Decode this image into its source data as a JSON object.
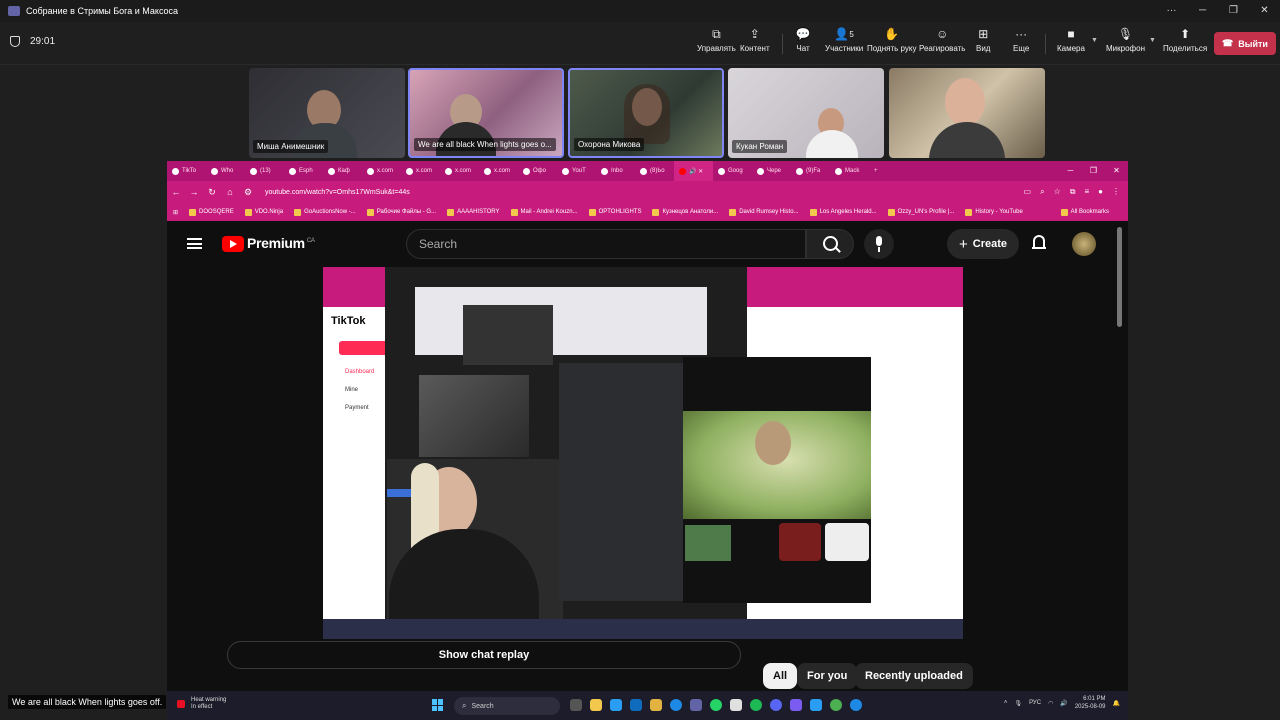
{
  "teams": {
    "window_title": "Собрание в Стримы Бога и Максоса",
    "timer": "29:01",
    "tools": [
      {
        "label": "Управлять",
        "icon": "control-icon"
      },
      {
        "label": "Контент",
        "icon": "share-content-icon"
      },
      {
        "label": "Чат",
        "icon": "chat-icon"
      },
      {
        "label": "Участники",
        "icon": "participants-icon",
        "count": "5"
      },
      {
        "label": "Поднять руку",
        "icon": "raise-hand-icon"
      },
      {
        "label": "Реагировать",
        "icon": "react-icon"
      },
      {
        "label": "Вид",
        "icon": "view-icon"
      },
      {
        "label": "Еще",
        "icon": "more-icon"
      },
      {
        "label": "Камера",
        "icon": "camera-icon"
      },
      {
        "label": "Микрофон",
        "icon": "microphone-icon"
      },
      {
        "label": "Поделиться",
        "icon": "share-icon"
      }
    ],
    "leave_label": "Выйти",
    "participants": [
      {
        "name": "Миша Анимешник"
      },
      {
        "name": "We are all black When lights goes o..."
      },
      {
        "name": "Охорона Микова"
      },
      {
        "name": "Кукан Роман"
      },
      {
        "name": ""
      }
    ]
  },
  "browser": {
    "tabs": [
      "TikTo",
      "Who",
      "(13)",
      "Esph",
      "Каф",
      "x.com",
      "x.com",
      "x.com",
      "x.com",
      "Офо",
      "YouT",
      "Inbo",
      "(8)Ьо",
      "",
      "Goog",
      "Чере",
      "(9)Fa",
      "Mack"
    ],
    "url": "youtube.com/watch?v=Omhs17WmSuk&t=44s",
    "bookmarks": [
      "DOOSQERE",
      "VDO.Ninja",
      "GoAuctionsNow -...",
      "Рабочие Файлы - G...",
      "AAAAHISTORY",
      "Mail - Andrei Kouzn...",
      "OPTOHLIGHTS",
      "Кузнецов Анатоли...",
      "David Rumsey Histo...",
      "Los Angeles Herald...",
      "Ozzy_UN's Profile |...",
      "History - YouTube"
    ],
    "all_bookmarks": "All Bookmarks"
  },
  "youtube": {
    "brand": "Premium",
    "region": "CA",
    "search_placeholder": "Search",
    "create_label": "Create",
    "chat_replay": "Show chat replay",
    "chips": [
      "All",
      "For you",
      "Recently uploaded"
    ]
  },
  "embedded": {
    "tiktok": "TikTok",
    "menu": [
      "Dashboard",
      "Mine",
      "Payment"
    ]
  },
  "taskbar": {
    "warning_title": "Heat warning",
    "warning_sub": "In effect",
    "search_label": "Search",
    "lang": "РУС",
    "time": "6:01 PM",
    "date": "2025-08-09"
  },
  "subtitle": "We are all black When lights goes off."
}
